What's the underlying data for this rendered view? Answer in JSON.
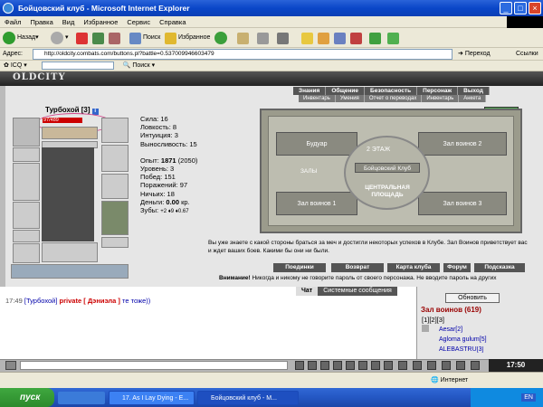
{
  "window": {
    "title": "Бойцовский клуб - Microsoft Internet Explorer"
  },
  "menu": [
    "Файл",
    "Правка",
    "Вид",
    "Избранное",
    "Сервис",
    "Справка"
  ],
  "toolbar": {
    "back": "Назад",
    "search": "Поиск",
    "favorites": "Избранное"
  },
  "address": {
    "label": "Адрес:",
    "url": "http://oldcity.combats.com/buttons.pl?battle=0.537009946603479",
    "go": "Переход",
    "links": "Ссылки"
  },
  "links_bar": {
    "icq": "ICQ",
    "search": "Поиск"
  },
  "game": {
    "logo": "OLDCITY",
    "nav": [
      "Знания",
      "Общение",
      "Безопасность",
      "Персонаж",
      "Выход"
    ],
    "subnav": [
      "Инвентарь",
      "Умения",
      "Отчет о переводах",
      "Инвентарь",
      "Анкета"
    ],
    "character": {
      "name": "Турбохой",
      "level": "[3]",
      "hp": "97/489"
    },
    "stats": {
      "strength": "Сила: 16",
      "agility": "Ловкость: 8",
      "intuition": "Интуиция: 3",
      "endurance": "Выносливость: 15",
      "experience_label": "Опыт:",
      "experience": "1871",
      "experience_next": "(2050)",
      "level": "Уровень: 3",
      "wins": "Побед: 151",
      "losses": "Поражений: 97",
      "draws": "Ничьих: 18",
      "money_label": "Деньги:",
      "money": "0.00",
      "money_unit": "кр.",
      "teeth": "Зубы:",
      "teeth_values": "+2 ♦9 ♦0.67"
    },
    "map": {
      "floor": "2 ЭТАЖ",
      "club": "Бойцовский Клуб",
      "boudoir": "Будуар",
      "hall2": "Зал воинов 2",
      "halls": "ЗАЛЫ",
      "hall1": "Зал воинов 1",
      "hall3": "Зал воинов 3",
      "square": "ЦЕНТРАЛЬНАЯ ПЛОЩАДЬ"
    },
    "welcome": "Вы уже знаете с какой стороны браться за меч и достигли некоторых успехов в Клубе. Зал Воинов приветствует вас и ждет ваших боев. Какими бы они ни были.",
    "buttons": [
      "Поединки",
      "Возврат",
      "Карта клуба",
      "Форум",
      "Подсказка"
    ],
    "warning_bold": "Внимание!",
    "warning": "Никогда и никому не говорите пароль от своего персонажа. Не вводите пароль на других"
  },
  "chat": {
    "tabs": [
      "Чат",
      "Системные сообщения"
    ],
    "line": {
      "time": "17:49",
      "who": "[Турбохой]",
      "private": "private",
      "target": "[ Дэниэла ]",
      "text": "те тоже))"
    }
  },
  "room": {
    "refresh": "Обновить",
    "title": "Зал воинов (619)",
    "pages": "[1][2][3]",
    "players": [
      "Aesar[2]",
      "Agloma gulum[5]",
      "ALEBASTRU[3]"
    ]
  },
  "clock": "17:50",
  "status": {
    "zone": "Интернет"
  },
  "taskbar": {
    "start": "пуск",
    "tasks": [
      "17. As I Lay Dying - E...",
      "Бойцовский клуб - M..."
    ],
    "lang": "EN"
  },
  "colors": {
    "accent": "#0a46c8",
    "hp": "#cc0000",
    "private": "#cc0000",
    "player_link": "#0000aa"
  }
}
